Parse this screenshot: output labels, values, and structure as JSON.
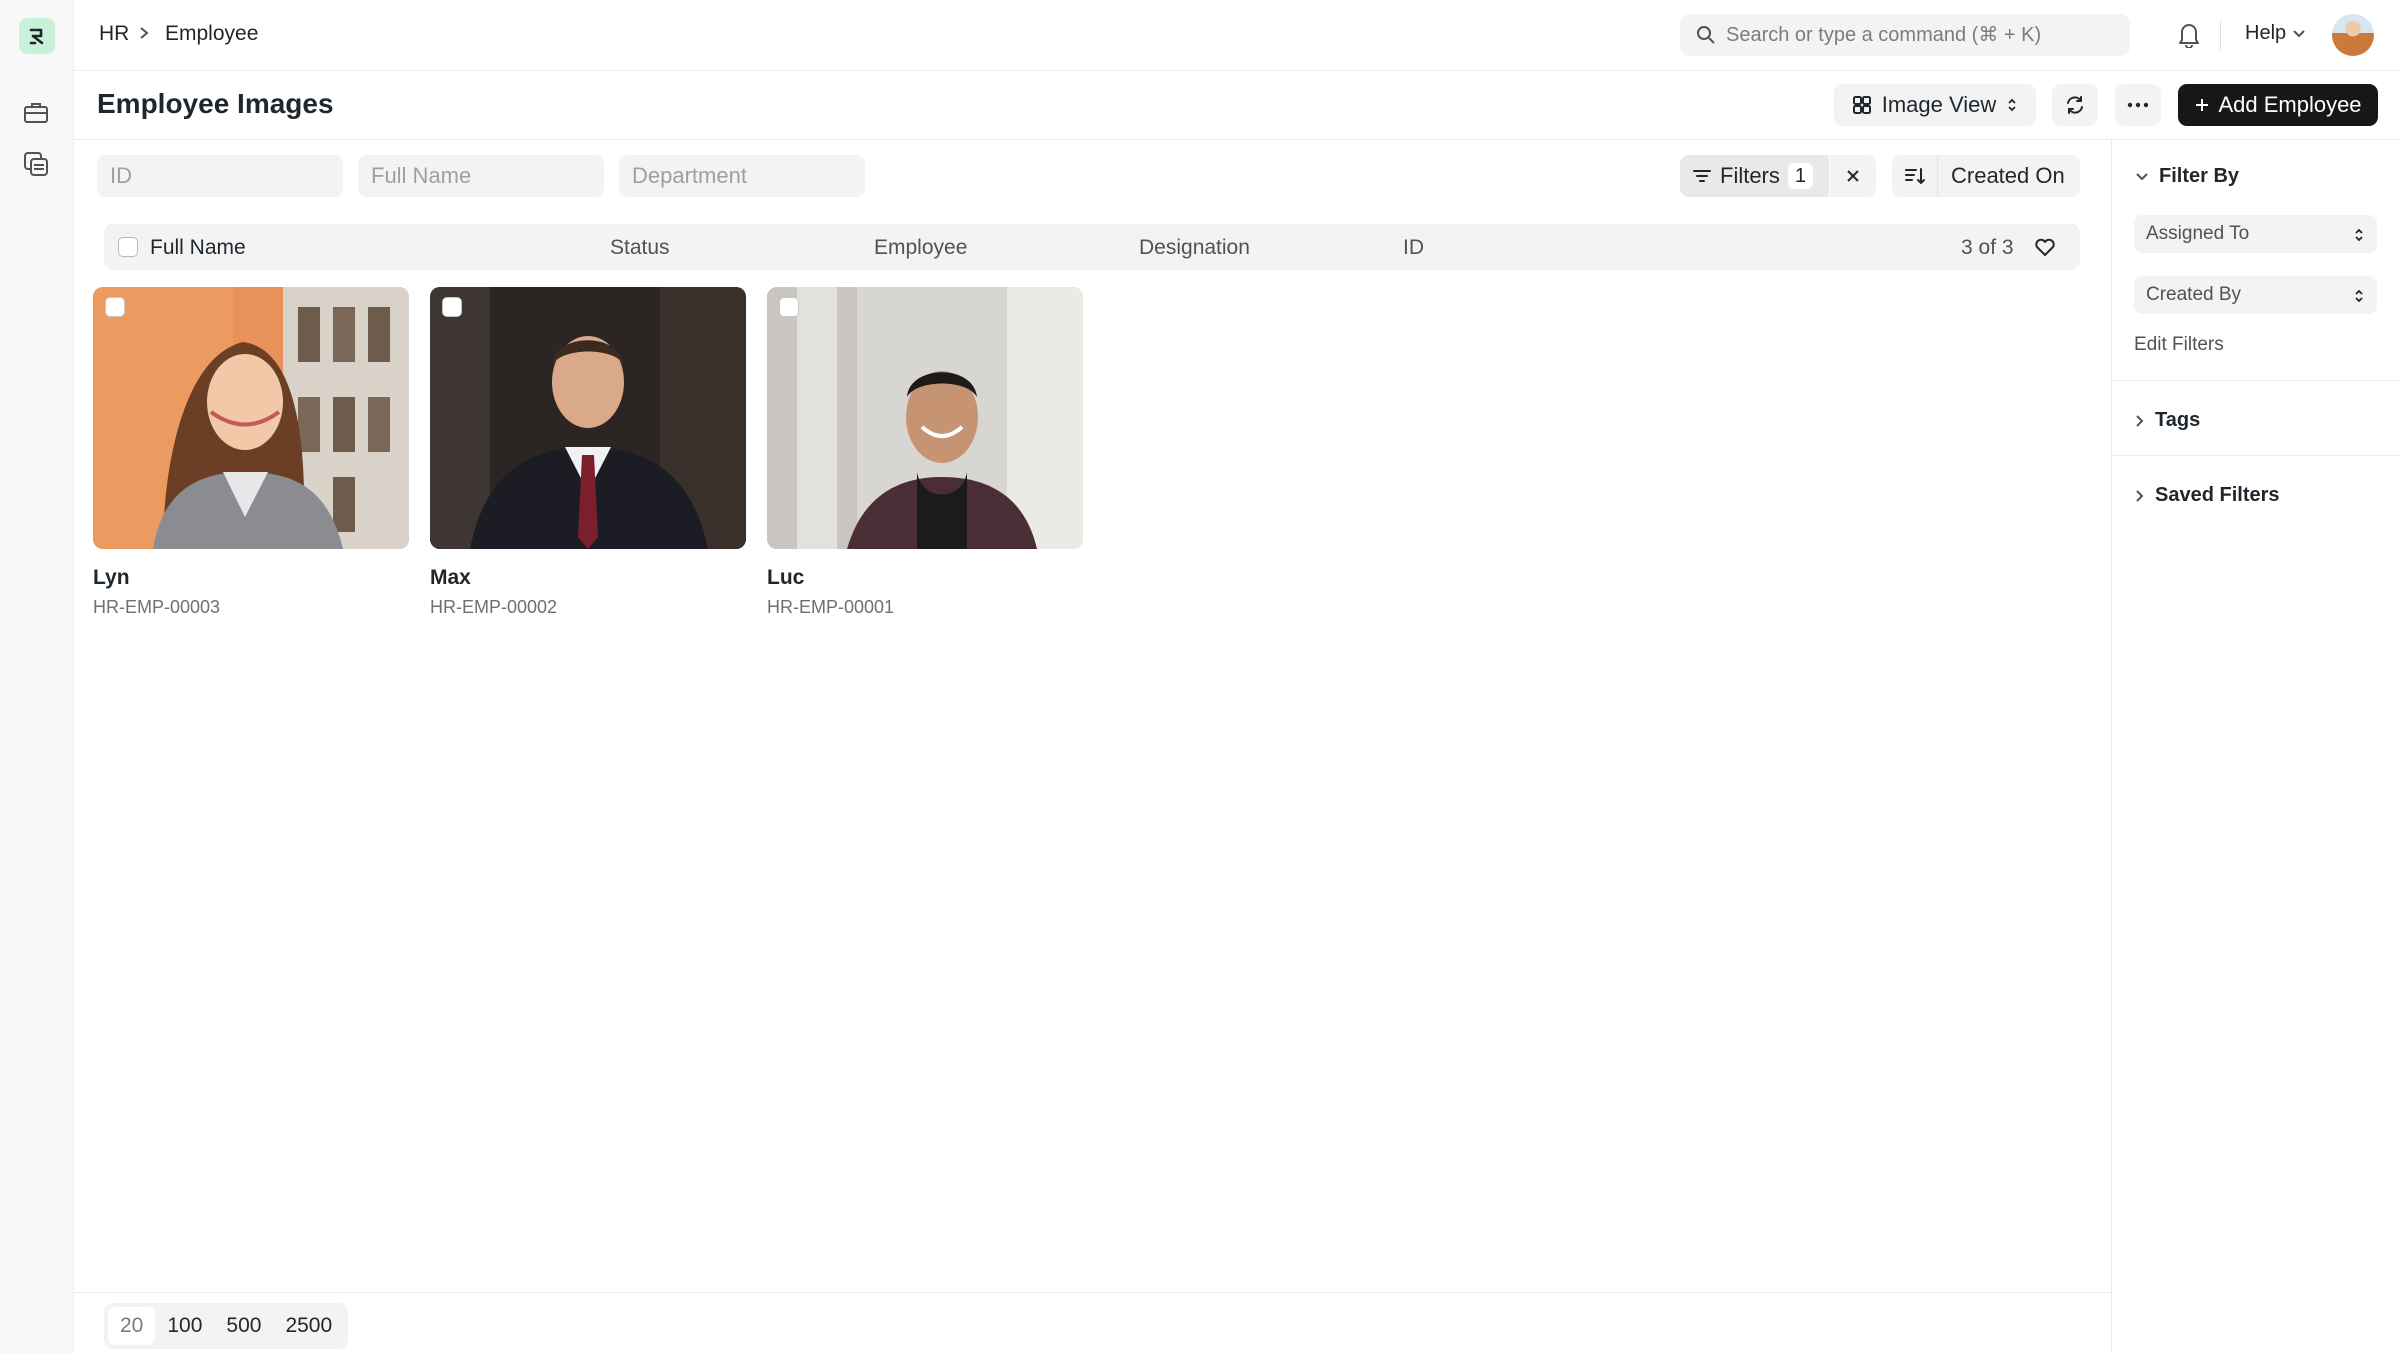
{
  "breadcrumb": {
    "root": "HR",
    "current": "Employee"
  },
  "search": {
    "placeholder": "Search or type a command (⌘ + K)"
  },
  "help": {
    "label": "Help"
  },
  "page": {
    "title": "Employee Images"
  },
  "toolbar": {
    "view_label": "Image View",
    "add_label": "Add Employee",
    "add_icon": "plus-icon"
  },
  "filters": {
    "id_placeholder": "ID",
    "full_name_placeholder": "Full Name",
    "department_placeholder": "Department",
    "filters_label": "Filters",
    "filters_count": "1",
    "sort_label": "Created On"
  },
  "list_header": {
    "columns": [
      "Full Name",
      "Status",
      "Employee",
      "Designation",
      "ID"
    ],
    "count": "3 of 3"
  },
  "cards": [
    {
      "name": "Lyn",
      "id": "HR-EMP-00003"
    },
    {
      "name": "Max",
      "id": "HR-EMP-00002"
    },
    {
      "name": "Luc",
      "id": "HR-EMP-00001"
    }
  ],
  "sidebar": {
    "filter_by": "Filter By",
    "assigned_to": "Assigned To",
    "created_by": "Created By",
    "edit_filters": "Edit Filters",
    "tags": "Tags",
    "saved_filters": "Saved Filters"
  },
  "pagination": {
    "sizes": [
      "20",
      "100",
      "500",
      "2500"
    ],
    "selected": "20"
  },
  "colors": {
    "accent": "#171717",
    "logo_bg": "#c9f0d9",
    "surface": "#f3f3f3"
  }
}
